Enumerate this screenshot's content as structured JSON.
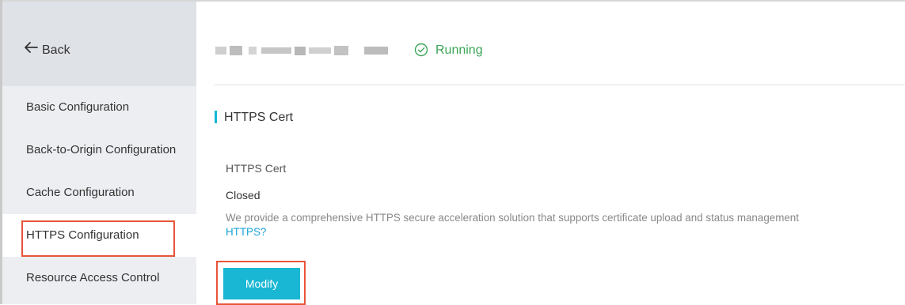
{
  "sidebar": {
    "back_label": "Back",
    "items": [
      {
        "label": "Basic Configuration"
      },
      {
        "label": "Back-to-Origin Configuration"
      },
      {
        "label": "Cache Configuration"
      },
      {
        "label": "HTTPS Configuration",
        "active": true
      },
      {
        "label": "Resource Access Control"
      }
    ]
  },
  "header": {
    "status_text": "Running",
    "status_icon": "check-circle-icon"
  },
  "section": {
    "title": "HTTPS Cert",
    "field_label": "HTTPS Cert",
    "field_value": "Closed",
    "description": "We provide a comprehensive HTTPS secure acceleration solution that supports certificate upload and status management",
    "link_text": "HTTPS?",
    "modify_label": "Modify"
  },
  "colors": {
    "accent": "#19b7d4",
    "status_green": "#3aa657",
    "highlight_red": "#e8543a",
    "link": "#1aa3d8"
  }
}
